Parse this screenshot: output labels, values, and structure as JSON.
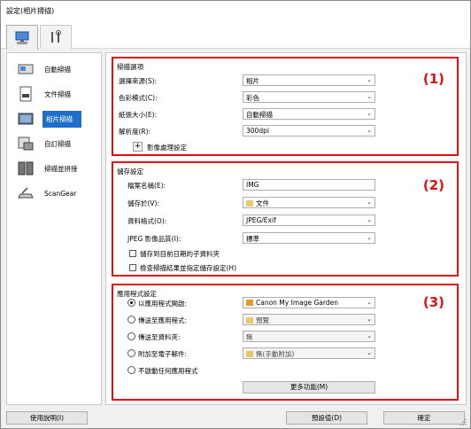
{
  "window": {
    "title": "設定(相片掃描)"
  },
  "tabs": [
    {
      "name": "scan-from-computer",
      "icon": "computer-scan-icon"
    },
    {
      "name": "general-settings",
      "icon": "tools-icon"
    }
  ],
  "sidebar": {
    "items": [
      {
        "label": "自動掃描",
        "icon": "auto-scan-icon"
      },
      {
        "label": "文件掃描",
        "icon": "document-scan-icon"
      },
      {
        "label": "相片掃描",
        "icon": "photo-scan-icon",
        "selected": true
      },
      {
        "label": "自訂掃描",
        "icon": "custom-scan-icon"
      },
      {
        "label": "掃描並拼接",
        "icon": "stitch-scan-icon"
      },
      {
        "label": "ScanGear",
        "icon": "scangear-icon"
      }
    ]
  },
  "scan_options": {
    "title": "掃描選項",
    "number": "(1)",
    "rows": [
      {
        "label": "選擇來源(S):",
        "value": "相片"
      },
      {
        "label": "色彩模式(C):",
        "value": "彩色"
      },
      {
        "label": "紙張大小(E):",
        "value": "自動掃描"
      },
      {
        "label": "解析度(R):",
        "value": "300dpi"
      }
    ],
    "image_processing": {
      "expand_symbol": "+",
      "label": "影像處理設定"
    }
  },
  "save_settings": {
    "title": "儲存設定",
    "number": "(2)",
    "file_name": {
      "label": "檔案名稱(E):",
      "value": "IMG"
    },
    "save_in": {
      "label": "儲存於(V):",
      "value": "文件"
    },
    "data_format": {
      "label": "資料格式(O):",
      "value": "JPEG/Exif"
    },
    "jpeg_quality": {
      "label": "JPEG 影像品質(I):",
      "value": "標準"
    },
    "checkbox_subfolder": "儲存到目前日期的子資料夾",
    "checkbox_check_results": "檢查掃描結果並指定儲存設定(H)"
  },
  "app_settings": {
    "title": "應用程式設定",
    "number": "(3)",
    "radios": [
      {
        "label": "以應用程式開啟:",
        "value": "Canon My Image Garden",
        "selected": true
      },
      {
        "label": "傳送至應用程式:",
        "value": "預覽"
      },
      {
        "label": "傳送至資料夾:",
        "value": "無"
      },
      {
        "label": "附加至電子郵件:",
        "value": "無(手動附加)"
      },
      {
        "label": "不啟動任何應用程式"
      }
    ],
    "more_functions_button": "更多功能(M)"
  },
  "footer": {
    "help_button": "使用說明(I)",
    "defaults_button": "預設值(D)",
    "ok_button": "確定"
  },
  "colors": {
    "highlight_red": "#e01010",
    "selected_blue": "#1e6fc9"
  }
}
